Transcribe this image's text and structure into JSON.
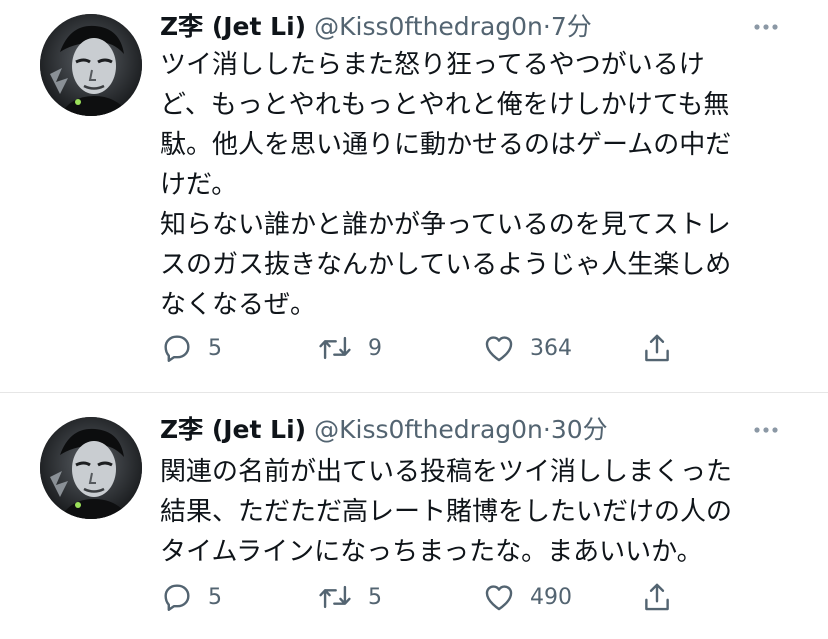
{
  "tweets": [
    {
      "author": {
        "display_name": "Z李 (Jet Li)",
        "handle": "@Kiss0fthedrag0n",
        "avatar_icon": "profile-photo"
      },
      "separator": "·",
      "time": "7分",
      "text": "ツイ消ししたらまた怒り狂ってるやつがいるけ\nど、もっとやれもっとやれと俺をけしかけても無\n駄。他人を思い通りに動かせるのはゲームの中だ\nけだ。\n知らない誰かと誰かが争っているのを見てストレ\nスのガス抜きなんかしているようじゃ人生楽しめ\nなくなるぜ。",
      "replies": "5",
      "retweets": "9",
      "likes": "364"
    },
    {
      "author": {
        "display_name": "Z李 (Jet Li)",
        "handle": "@Kiss0fthedrag0n",
        "avatar_icon": "profile-photo"
      },
      "separator": "·",
      "time": "30分",
      "text": "関連の名前が出ている投稿をツイ消ししまくった\n結果、ただただ高レート賭博をしたいだけの人の\nタイムラインになっちまったな。まあいいか。",
      "replies": "5",
      "retweets": "5",
      "likes": "490"
    }
  ],
  "icons": {
    "reply": "reply-icon",
    "retweet": "retweet-icon",
    "like": "like-icon",
    "share": "share-icon",
    "more": "more-icon"
  },
  "colors": {
    "text": "#0f1419",
    "secondary": "#536471",
    "divider": "#e6e6e6"
  }
}
